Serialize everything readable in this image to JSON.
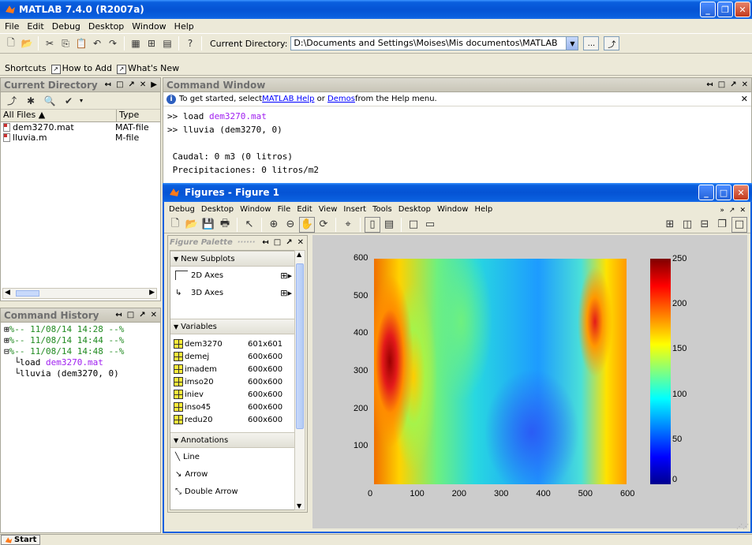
{
  "window": {
    "title": "MATLAB  7.4.0 (R2007a)"
  },
  "menu": [
    "File",
    "Edit",
    "Debug",
    "Desktop",
    "Window",
    "Help"
  ],
  "toolbar": {
    "curdir_label": "Current Directory:",
    "curdir_value": "D:\\Documents and Settings\\Moises\\Mis documentos\\MATLAB",
    "browse_label": "..."
  },
  "shortcuts": {
    "label": "Shortcuts",
    "how_to_add": "How to Add",
    "whats_new": "What's New"
  },
  "current_directory": {
    "title": "Current Directory",
    "columns": [
      "All Files",
      "Type"
    ],
    "files": [
      {
        "name": "dem3270.mat",
        "type": "MAT-file"
      },
      {
        "name": "lluvia.m",
        "type": "M-file"
      }
    ]
  },
  "history": {
    "title": "Command History",
    "sessions": [
      {
        "marker": "⊞",
        "text": "%-- 11/08/14 14:28 --%"
      },
      {
        "marker": "⊞",
        "text": "%-- 11/08/14 14:44 --%"
      },
      {
        "marker": "⊟",
        "text": "%-- 11/08/14 14:48 --%"
      }
    ],
    "commands": [
      {
        "prefix": "load ",
        "arg": "dem3270.mat"
      },
      {
        "prefix": "lluvia (dem3270, 0)",
        "arg": ""
      }
    ]
  },
  "command_window": {
    "title": "Command Window",
    "info_prefix": "To get started, select ",
    "info_link1": "MATLAB Help",
    "info_middle": " or ",
    "info_link2": "Demos",
    "info_suffix": " from the Help menu.",
    "lines": [
      {
        "prompt": ">> ",
        "cmd": "load ",
        "arg": "dem3270.mat"
      },
      {
        "prompt": ">> ",
        "cmd": "lluvia (dem3270, 0)",
        "arg": ""
      }
    ],
    "output": [
      "Caudal: 0 m3 (0 litros)",
      "Precipitaciones: 0 litros/m2"
    ]
  },
  "figure": {
    "title": "Figures - Figure 1",
    "menu": [
      "Debug",
      "Desktop",
      "Window",
      "File",
      "Edit",
      "View",
      "Insert",
      "Tools",
      "Desktop",
      "Window",
      "Help"
    ],
    "palette_title": "Figure Palette",
    "sections": {
      "new_subplots": "New Subplots",
      "variables": "Variables",
      "annotations": "Annotations"
    },
    "subplots": [
      "2D Axes",
      "3D Axes"
    ],
    "variables": [
      {
        "name": "dem3270",
        "size": "601x601"
      },
      {
        "name": "demej",
        "size": "600x600"
      },
      {
        "name": "imadem",
        "size": "600x600"
      },
      {
        "name": "imso20",
        "size": "600x600"
      },
      {
        "name": "iniev",
        "size": "600x600"
      },
      {
        "name": "inso45",
        "size": "600x600"
      },
      {
        "name": "redu20",
        "size": "600x600"
      }
    ],
    "annotations": [
      "Line",
      "Arrow",
      "Double Arrow"
    ]
  },
  "chart_data": {
    "type": "heatmap",
    "xlim": [
      0,
      600
    ],
    "ylim": [
      0,
      600
    ],
    "x_ticks": [
      "0",
      "100",
      "200",
      "300",
      "400",
      "500",
      "600"
    ],
    "y_ticks": [
      "100",
      "200",
      "300",
      "400",
      "500",
      "600"
    ],
    "colorbar": {
      "range": [
        0,
        250
      ],
      "ticks": [
        "250",
        "200",
        "150",
        "100",
        "50",
        "0"
      ],
      "colormap": "jet"
    },
    "grid": false
  },
  "taskbar": {
    "start": "Start"
  },
  "colors": {
    "titlebar": "#0553d4",
    "link": "#0000ff",
    "comment_green": "#228b22",
    "string_purple": "#a020f0"
  }
}
